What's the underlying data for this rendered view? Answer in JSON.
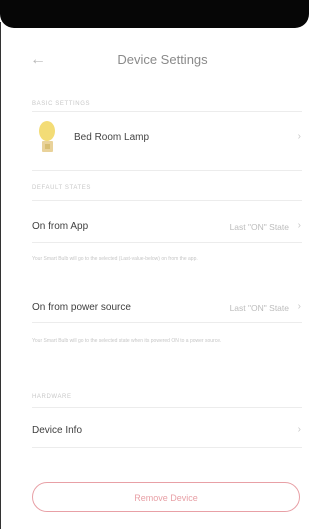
{
  "header": {
    "title": "Device Settings"
  },
  "device_section": {
    "heading": "BASIC SETTINGS",
    "device_name": "Bed Room Lamp"
  },
  "default_state_section": {
    "heading": "DEFAULT STATES",
    "on_from_app": {
      "label": "On from App",
      "value": "Last \"ON\" State",
      "description": "Your Smart Bulb will go to the selected (Last-value-below) on from the app."
    },
    "on_from_power": {
      "label": "On from power source",
      "value": "Last \"ON\" State",
      "description": "Your Smart Bulb will go to the selected state when its powered ON to a power source."
    }
  },
  "hardware_section": {
    "heading": "HARDWARE",
    "device_info_label": "Device Info"
  },
  "remove_button_label": "Remove Device",
  "colors": {
    "remove_accent": "#e8a0a6",
    "status_bar": "#060606",
    "lamp_yellow": "#f3dc76"
  }
}
